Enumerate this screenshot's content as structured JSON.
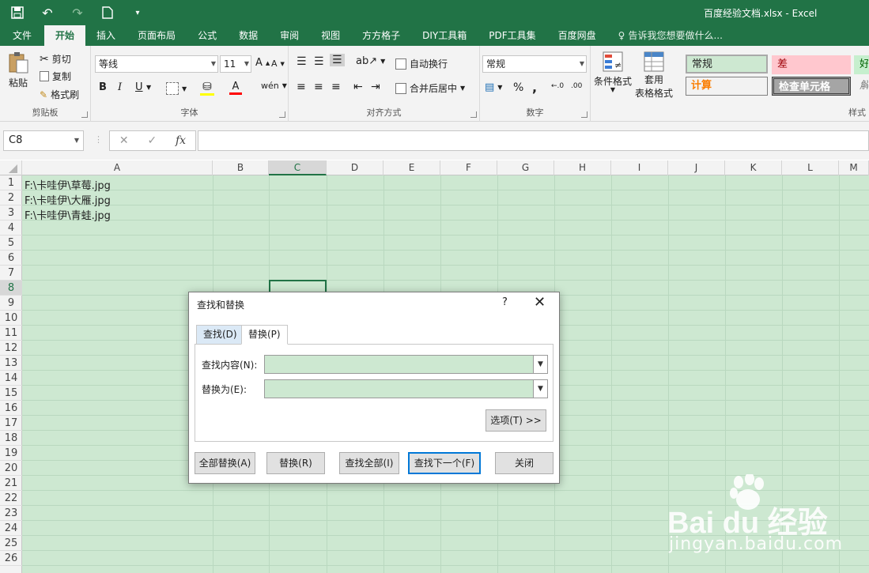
{
  "window": {
    "title": "百度经验文档.xlsx - Excel"
  },
  "tabs": [
    "文件",
    "开始",
    "插入",
    "页面布局",
    "公式",
    "数据",
    "审阅",
    "视图",
    "方方格子",
    "DIY工具箱",
    "PDF工具集",
    "百度网盘"
  ],
  "active_tab": "开始",
  "tell_me": "告诉我您想要做什么...",
  "ribbon": {
    "clipboard": {
      "label": "剪贴板",
      "paste": "粘贴",
      "cut": "剪切",
      "copy": "复制",
      "format_painter": "格式刷"
    },
    "font": {
      "label": "字体",
      "font_name": "等线",
      "font_size": "11",
      "bold": "B",
      "italic": "I",
      "underline": "U"
    },
    "alignment": {
      "label": "对齐方式",
      "wrap_text": "自动换行",
      "merge_center": "合并后居中"
    },
    "number": {
      "label": "数字",
      "format": "常规",
      "percent": "%",
      "comma": ","
    },
    "styles": {
      "label": "样式",
      "conditional_format": "条件格式",
      "table_format_line1": "套用",
      "table_format_line2": "表格格式",
      "cells": [
        "常规",
        "差",
        "好",
        "计算",
        "检查单元格",
        "解"
      ]
    }
  },
  "formula_bar": {
    "name_box": "C8",
    "cancel": "✕",
    "enter": "✓",
    "fx": "fx",
    "content": ""
  },
  "grid": {
    "columns": [
      "A",
      "B",
      "C",
      "D",
      "E",
      "F",
      "G",
      "H",
      "I",
      "J",
      "K",
      "L",
      "M"
    ],
    "rows": [
      "1",
      "2",
      "3",
      "4",
      "5",
      "6",
      "7",
      "8",
      "9",
      "10",
      "11",
      "12",
      "13",
      "14",
      "15",
      "16",
      "17",
      "18",
      "19",
      "20",
      "21",
      "22",
      "23",
      "24",
      "25",
      "26"
    ],
    "selected_column": "C",
    "selected_row": "8",
    "cells": [
      "F:\\卡哇伊\\草莓.jpg",
      "F:\\卡哇伊\\大雁.jpg",
      "F:\\卡哇伊\\青蛙.jpg"
    ]
  },
  "dialog": {
    "title": "查找和替换",
    "help": "?",
    "close": "✕",
    "tab_find": "查找(D)",
    "tab_replace": "替换(P)",
    "find_label": "查找内容(N):",
    "find_value": "",
    "replace_label": "替换为(E):",
    "replace_value": "",
    "options_button": "选项(T) >>",
    "replace_all": "全部替换(A)",
    "replace": "替换(R)",
    "find_all": "查找全部(I)",
    "find_next": "查找下一个(F)",
    "close_button": "关闭"
  },
  "watermark": {
    "brand": "Bai du 经验",
    "url": "jingyan.baidu.com"
  },
  "colors": {
    "excel_green": "#217346",
    "cell_bg": "#cde8d1",
    "focus_blue": "#0078d7"
  }
}
